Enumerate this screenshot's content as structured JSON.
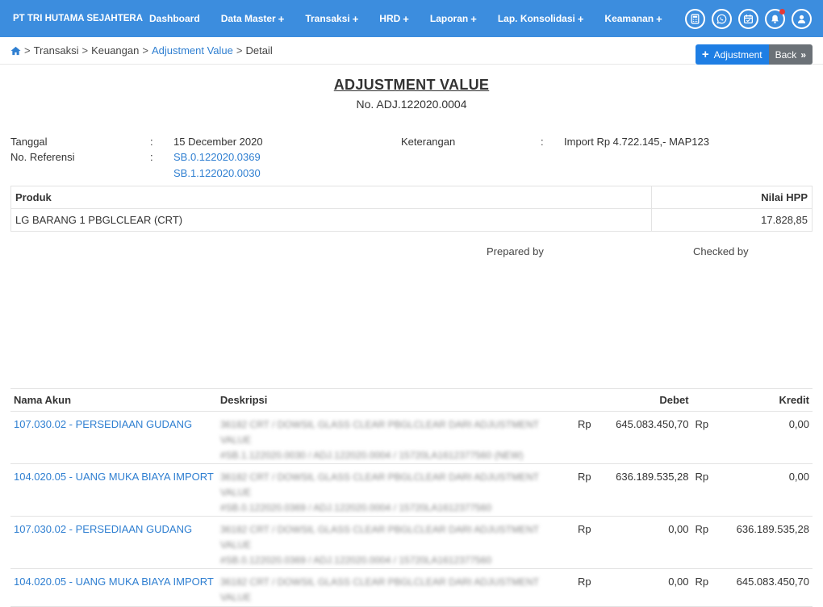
{
  "brand": "PT TRI HUTAMA SEJAHTERA",
  "nav": [
    {
      "label": "Dashboard",
      "plus": ""
    },
    {
      "label": "Data Master",
      "plus": "+"
    },
    {
      "label": "Transaksi",
      "plus": "+"
    },
    {
      "label": "HRD",
      "plus": "+"
    },
    {
      "label": "Laporan",
      "plus": "+"
    },
    {
      "label": "Lap. Konsolidasi",
      "plus": "+"
    },
    {
      "label": "Keamanan",
      "plus": "+"
    }
  ],
  "nav_icons": [
    "calculator-icon",
    "whatsapp-icon",
    "calendar-icon",
    "bell-icon",
    "user-icon"
  ],
  "breadcrumb": {
    "sep": ">",
    "transaksi": "Transaksi",
    "keuangan": "Keuangan",
    "adjustment": "Adjustment Value",
    "detail": "Detail"
  },
  "buttons": {
    "adjustment": "Adjustment",
    "back": "Back"
  },
  "doc": {
    "title": "ADJUSTMENT VALUE",
    "number": "No. ADJ.122020.0004",
    "tanggal_label": "Tanggal",
    "tanggal_value": "15 December 2020",
    "ref_label": "No. Referensi",
    "ref_values": [
      "SB.0.122020.0369",
      "SB.1.122020.0030"
    ],
    "ket_label": "Keterangan",
    "ket_value": "Import Rp 4.722.145,- MAP123",
    "colon": ":"
  },
  "product_table": {
    "headers": [
      "Produk",
      "Nilai HPP"
    ],
    "rows": [
      {
        "produk": "LG BARANG 1 PBGLCLEAR (CRT)",
        "nilai": "17.828,85"
      }
    ]
  },
  "signatures": {
    "prepared": "Prepared by",
    "checked": "Checked by"
  },
  "journal": {
    "headers": [
      "Nama Akun",
      "Deskripsi",
      "Debet",
      "Kredit"
    ],
    "currency": "Rp",
    "rows": [
      {
        "akun": "107.030.02 - PERSEDIAAN GUDANG",
        "desc1": "36182 CRT / DOWSIL GLASS CLEAR PBGLCLEAR DARI ADJUSTMENT VALUE",
        "desc2": "#SB.1.122020.0030 / ADJ.122020.0004 / 15720LA1612377560 (NEW)",
        "debet": "645.083.450,70",
        "kredit": "0,00"
      },
      {
        "akun": "104.020.05 - UANG MUKA BIAYA IMPORT",
        "desc1": "36182 CRT / DOWSIL GLASS CLEAR PBGLCLEAR DARI ADJUSTMENT VALUE",
        "desc2": "#SB.0.122020.0369 / ADJ.122020.0004 / 15720LA1612377560",
        "debet": "636.189.535,28",
        "kredit": "0,00"
      },
      {
        "akun": "107.030.02 - PERSEDIAAN GUDANG",
        "desc1": "36182 CRT / DOWSIL GLASS CLEAR PBGLCLEAR DARI ADJUSTMENT VALUE",
        "desc2": "#SB.0.122020.0369 / ADJ.122020.0004 / 15720LA1612377560",
        "debet": "0,00",
        "kredit": "636.189.535,28"
      },
      {
        "akun": "104.020.05 - UANG MUKA BIAYA IMPORT",
        "desc1": "36182 CRT / DOWSIL GLASS CLEAR PBGLCLEAR DARI ADJUSTMENT VALUE",
        "desc2": "",
        "debet": "0,00",
        "kredit": "645.083.450,70"
      }
    ]
  },
  "colors": {
    "navbar": "#3c8dde",
    "link": "#2f7fd1",
    "button_primary": "#1e7ee4",
    "button_back": "#6b7177"
  }
}
